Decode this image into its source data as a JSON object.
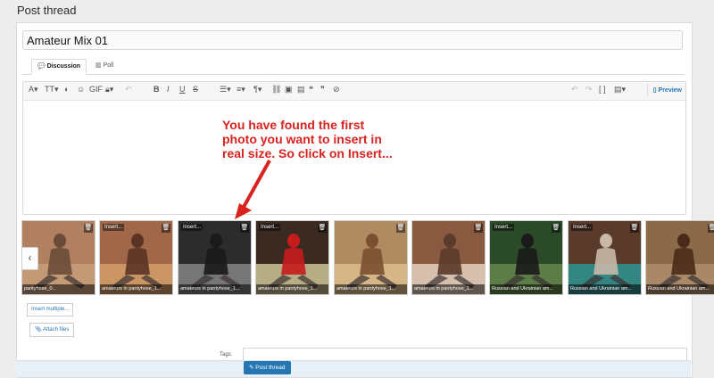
{
  "page": {
    "title": "Post thread"
  },
  "thread": {
    "title_value": "Amateur Mix 01"
  },
  "tabs": [
    {
      "label": "Discussion",
      "icon": "chat-icon"
    },
    {
      "label": "Poll",
      "icon": "bar-chart-icon"
    }
  ],
  "editor": {
    "preview_label": "Preview"
  },
  "annotation": {
    "line1": "You have found the first",
    "line2": "photo you want to insert in",
    "line3": "real size. So click on Insert..."
  },
  "attachments": [
    {
      "caption": "pantyhose_0...",
      "insert": "",
      "colors": [
        "#b08060",
        "#c8a07a",
        "#6a4a38"
      ]
    },
    {
      "caption": "amateurs in pantyhose_1...",
      "insert": "Insert...",
      "colors": [
        "#a06848",
        "#d7a06c",
        "#5a3324"
      ]
    },
    {
      "caption": "amateurs in pantyhose_1...",
      "insert": "Insert...",
      "colors": [
        "#2c2c2c",
        "#8a8a8a",
        "#1a1a1a"
      ]
    },
    {
      "caption": "amateurs in pantyhose_1...",
      "insert": "Insert...",
      "colors": [
        "#3a2a22",
        "#d8d0a0",
        "#c41c1c"
      ]
    },
    {
      "caption": "amateurs in pantyhose_1...",
      "insert": "",
      "colors": [
        "#b08a60",
        "#e0c090",
        "#7a5030"
      ]
    },
    {
      "caption": "amateurs in pantyhose_1...",
      "insert": "",
      "colors": [
        "#8a5a40",
        "#e8d8c8",
        "#5a3a2a"
      ]
    },
    {
      "caption": "Russian and Ukrainian am...",
      "insert": "Insert...",
      "colors": [
        "#2a4a28",
        "#6a8a50",
        "#1a1a1a"
      ]
    },
    {
      "caption": "Russian and Ukrainian am...",
      "insert": "Insert...",
      "colors": [
        "#5a3a2a",
        "#2a9a9a",
        "#c8b8a8"
      ]
    },
    {
      "caption": "Russian and Ukrainian am...",
      "insert": "",
      "colors": [
        "#8a6a48",
        "#b09070",
        "#4a2a1a"
      ]
    }
  ],
  "buttons": {
    "insert_multiple": "Insert multiple...",
    "attach_files": "Attach files",
    "post_thread": "Post thread"
  },
  "tags": {
    "label": "Tags:"
  }
}
